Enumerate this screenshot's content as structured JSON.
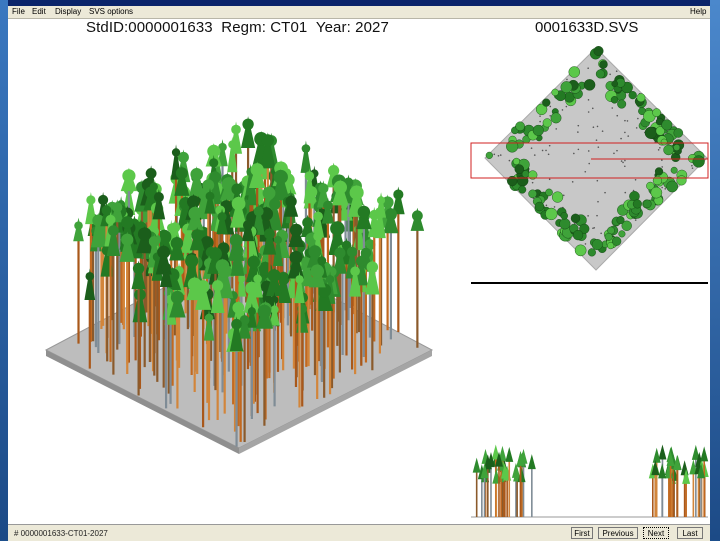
{
  "menu": {
    "file": "File",
    "edit": "Edit",
    "display": "Display",
    "svs_options": "SVS options",
    "help": "Help"
  },
  "header": {
    "stand_id_label": "StdID:",
    "stand_id": "0000001633",
    "regime_label": "Regm:",
    "regime": "CT01",
    "year_label": "Year:",
    "year": "2027",
    "filename": "0001633D.SVS"
  },
  "status": {
    "text": "# 0000001633-CT01-2027",
    "buttons": {
      "first": "First",
      "previous": "Previous",
      "next": "Next",
      "last": "Last"
    }
  },
  "colors": {
    "tree_dark": "#1b5e1b",
    "tree_mid": "#2e8b2e",
    "tree_light": "#5cc84a",
    "trunk_orange": "#c2691f",
    "trunk_gray": "#7f8c96",
    "ground": "#b9b9b9",
    "selection_box": "#d02020"
  }
}
